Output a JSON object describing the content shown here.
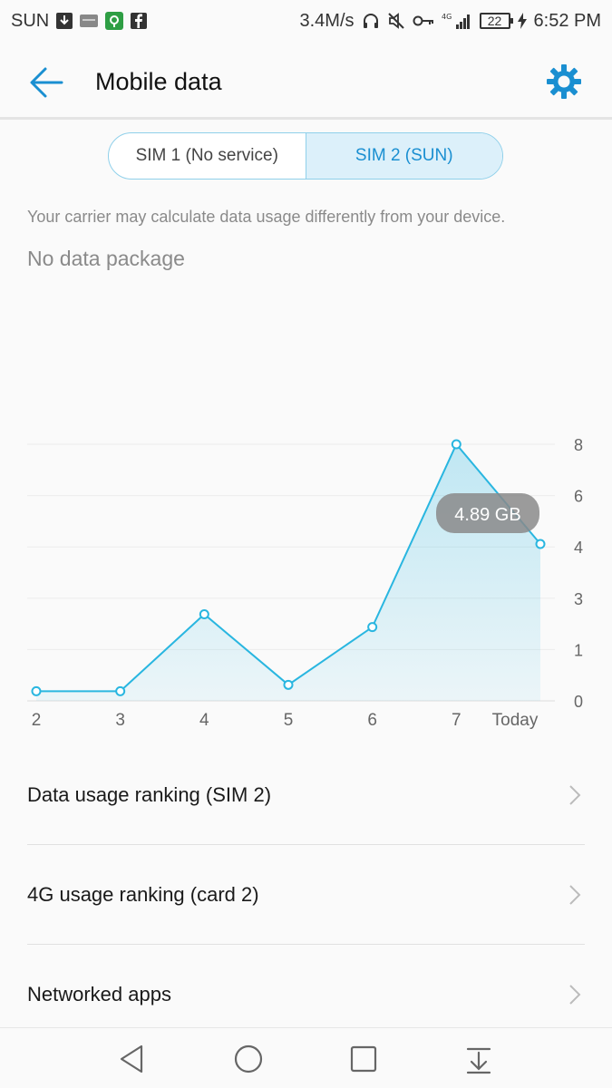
{
  "status_bar": {
    "carrier": "SUN",
    "speed": "3.4M/s",
    "network": "4G",
    "battery": "22",
    "time": "6:52 PM",
    "icons": [
      "download-icon",
      "notification-icon",
      "vpn-shield-icon",
      "facebook-icon",
      "headphones-icon",
      "mute-icon",
      "key-icon",
      "signal-icon",
      "battery-icon",
      "charging-icon"
    ]
  },
  "header": {
    "title": "Mobile data",
    "back_icon": "back-arrow-icon",
    "settings_icon": "gear-icon"
  },
  "sim_tabs": [
    {
      "label": "SIM 1 (No service)",
      "active": false
    },
    {
      "label": "SIM 2 (SUN)",
      "active": true
    }
  ],
  "carrier_note": "Your carrier may calculate data usage differently from your device.",
  "package_status": "No data package",
  "chart_data": {
    "type": "area",
    "categories": [
      "2",
      "3",
      "4",
      "5",
      "6",
      "7",
      "Today"
    ],
    "values": [
      0.3,
      0.3,
      2.7,
      0.5,
      2.3,
      8.0,
      4.89
    ],
    "y_ticks": [
      0,
      1,
      3,
      4,
      6,
      8
    ],
    "ylim": [
      0,
      8
    ],
    "highlight_label": "4.89 GB",
    "grid": true,
    "color": "#29b6e0"
  },
  "list": [
    {
      "label": "Data usage ranking (SIM 2)"
    },
    {
      "label": "4G usage ranking (card 2)"
    },
    {
      "label": "Networked apps"
    }
  ],
  "nav": {
    "icons": [
      "back-triangle-icon",
      "home-circle-icon",
      "recents-square-icon",
      "notification-pull-icon"
    ]
  }
}
